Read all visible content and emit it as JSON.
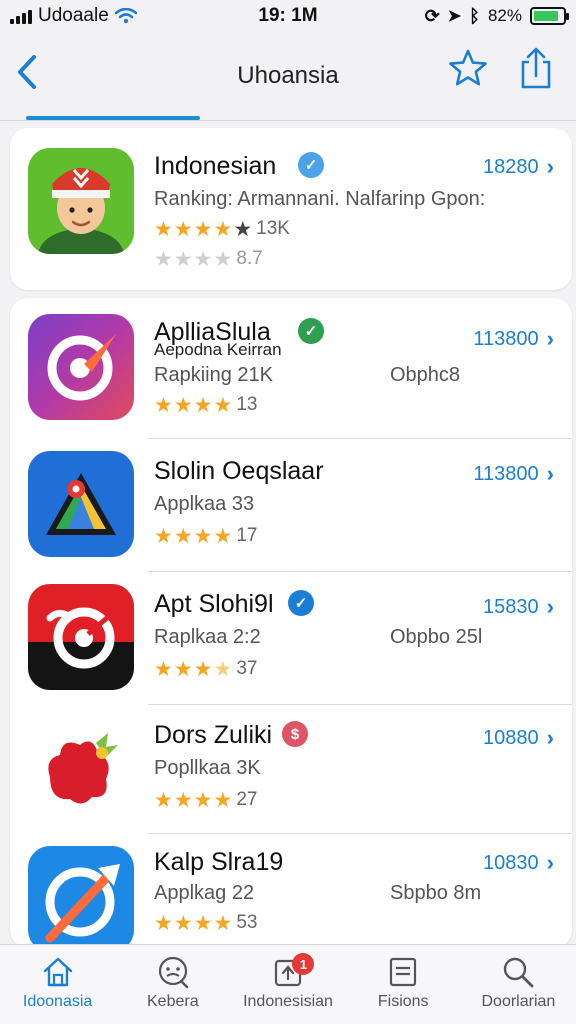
{
  "status_bar": {
    "carrier": "Udoaale",
    "time": "19: 1M",
    "battery": "82%"
  },
  "nav": {
    "title": "Uhoansia"
  },
  "featured": {
    "name": "Indonesian",
    "subtitle": "Ranking: Armannani. Nalfarinp Gpon:",
    "rating_count": "13K",
    "rating_stars": 4.5,
    "secondary_rating": "8.7",
    "action_label": "18280",
    "badge_color": "#4aa3e8"
  },
  "apps": [
    {
      "name": "AplliaSlula",
      "name_overlay": "Aepodna Keirran",
      "sub": "Rapkiing 21K",
      "sub2": "Obphc8",
      "rating_stars": 4,
      "rating_count": "13",
      "action_label": "113800",
      "badge_color": "#2e9e4f",
      "badge_glyph": "✓"
    },
    {
      "name": "Slolin Oeqslaar",
      "sub": "Applkaa 33",
      "sub2": "",
      "rating_stars": 4,
      "rating_count": "17",
      "action_label": "113800",
      "badge_color": "",
      "badge_glyph": ""
    },
    {
      "name": "Apt Slohi9l",
      "sub": "Raplkaa 2:2",
      "sub2": "Obpbo 25l",
      "rating_stars": 3.5,
      "rating_count": "37",
      "action_label": "15830",
      "badge_color": "#1a7fd4",
      "badge_glyph": "✓"
    },
    {
      "name": "Dors Zuliki",
      "sub": "Popllkaa 3K",
      "sub2": "",
      "rating_stars": 4,
      "rating_count": "27",
      "action_label": "10880",
      "badge_color": "#e05565",
      "badge_glyph": "$"
    },
    {
      "name": "Kalp Slra19",
      "sub": "Applkag 22",
      "sub2": "Sbpbo 8m",
      "rating_stars": 4,
      "rating_count": "53",
      "action_label": "10830",
      "badge_color": "",
      "badge_glyph": ""
    }
  ],
  "tabs": [
    {
      "label": "Idoonasia",
      "icon": "home-icon",
      "active": true
    },
    {
      "label": "Kebera",
      "icon": "chat-face-icon",
      "active": false
    },
    {
      "label": "Indonesisian",
      "icon": "updates-icon",
      "active": false,
      "badge": "1"
    },
    {
      "label": "Fisions",
      "icon": "list-box-icon",
      "active": false
    },
    {
      "label": "Doorlarian",
      "icon": "search-icon",
      "active": false
    }
  ],
  "colors": {
    "accent": "#1a7fd4",
    "star": "#f5a623"
  }
}
